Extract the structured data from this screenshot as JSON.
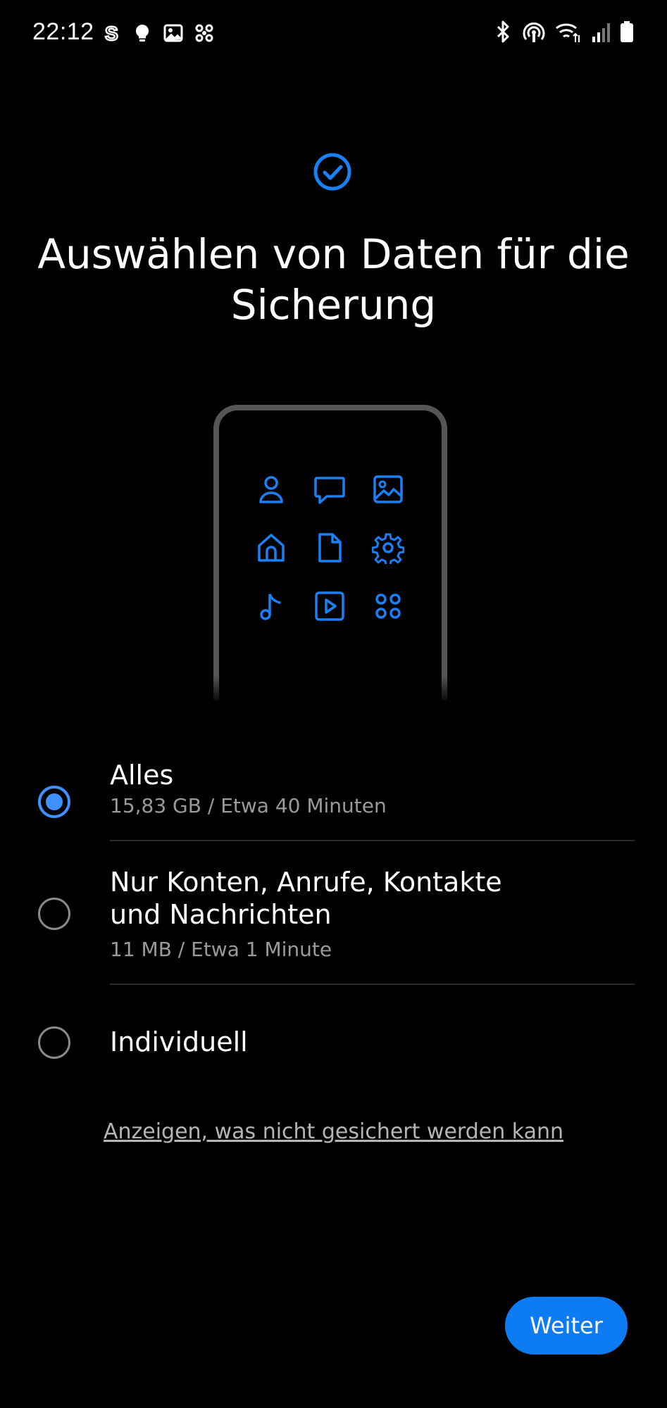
{
  "status_bar": {
    "time": "22:12",
    "left_icons": [
      "s-icon",
      "bulb-icon",
      "image-icon",
      "flower-icon"
    ],
    "right_icons": [
      "bluetooth-icon",
      "hotspot-icon",
      "wifi-icon",
      "signal-icon",
      "battery-icon"
    ]
  },
  "header": {
    "title": "Auswählen von Daten für die Sicherung",
    "icon": "check-circle-icon"
  },
  "illustration": {
    "icons": [
      "person-icon",
      "message-icon",
      "image-icon",
      "home-icon",
      "document-icon",
      "settings-icon",
      "music-icon",
      "play-icon",
      "apps-icon"
    ]
  },
  "options": [
    {
      "label": "Alles",
      "sub": "15,83 GB / Etwa 40 Minuten",
      "selected": true
    },
    {
      "label": "Nur Konten, Anrufe, Kontakte und Nachrichten",
      "sub": "11 MB / Etwa 1 Minute",
      "selected": false
    },
    {
      "label": "Individuell",
      "sub": "",
      "selected": false
    }
  ],
  "link_text": "Anzeigen, was nicht gesichert werden kann",
  "next_button": "Weiter",
  "colors": {
    "accent": "#3e91ff",
    "button": "#0d7cf2",
    "icon_blue": "#1a80f5"
  }
}
